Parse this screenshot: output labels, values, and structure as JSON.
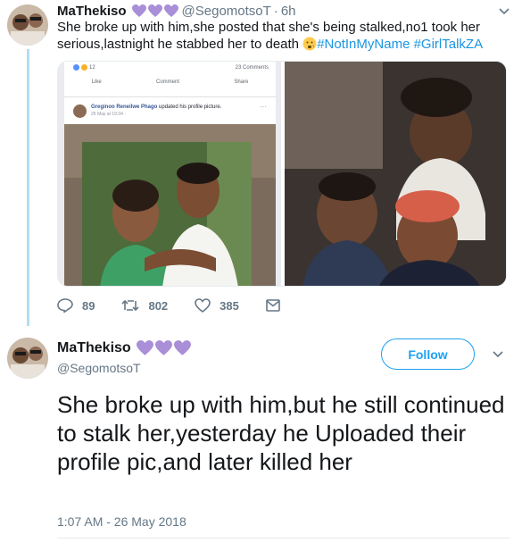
{
  "tweet1": {
    "display_name": "MaThekiso",
    "handle": "@SegomotsoT",
    "dot": "·",
    "time": "6h",
    "text": "She broke up with him,she posted that she's being stalked,no1 took her serious,lastnight he stabbed her to death",
    "emoji": "worried-crying-face-emoji",
    "hashtags": [
      "#NotInMyName",
      "#GirlTalkZA"
    ],
    "facebook_screenshot": {
      "reactions_count": "12",
      "comments_count": "23 Comments",
      "like_label": "Like",
      "comment_label": "Comment",
      "share_label": "Share",
      "poster_name": "Greginoo Reneilwe Phago",
      "action_text": "updated his profile picture.",
      "post_date": "25 May at 19:34 ·",
      "more": "···"
    },
    "actions": {
      "replies": "89",
      "retweets": "802",
      "likes": "385"
    }
  },
  "tweet2": {
    "display_name": "MaThekiso",
    "handle": "@SegomotsoT",
    "follow_label": "Follow",
    "text": "She broke up with him,but he still continued to stalk her,yesterday he Uploaded their profile pic,and later killed her",
    "timestamp": "1:07 AM - 26 May 2018"
  },
  "icons": {
    "heart_color": "#a98ed8",
    "caret": "chevron-down-icon",
    "accent": "#1da1f2",
    "hashtag_color": "#1b95e0",
    "muted": "#657786"
  }
}
